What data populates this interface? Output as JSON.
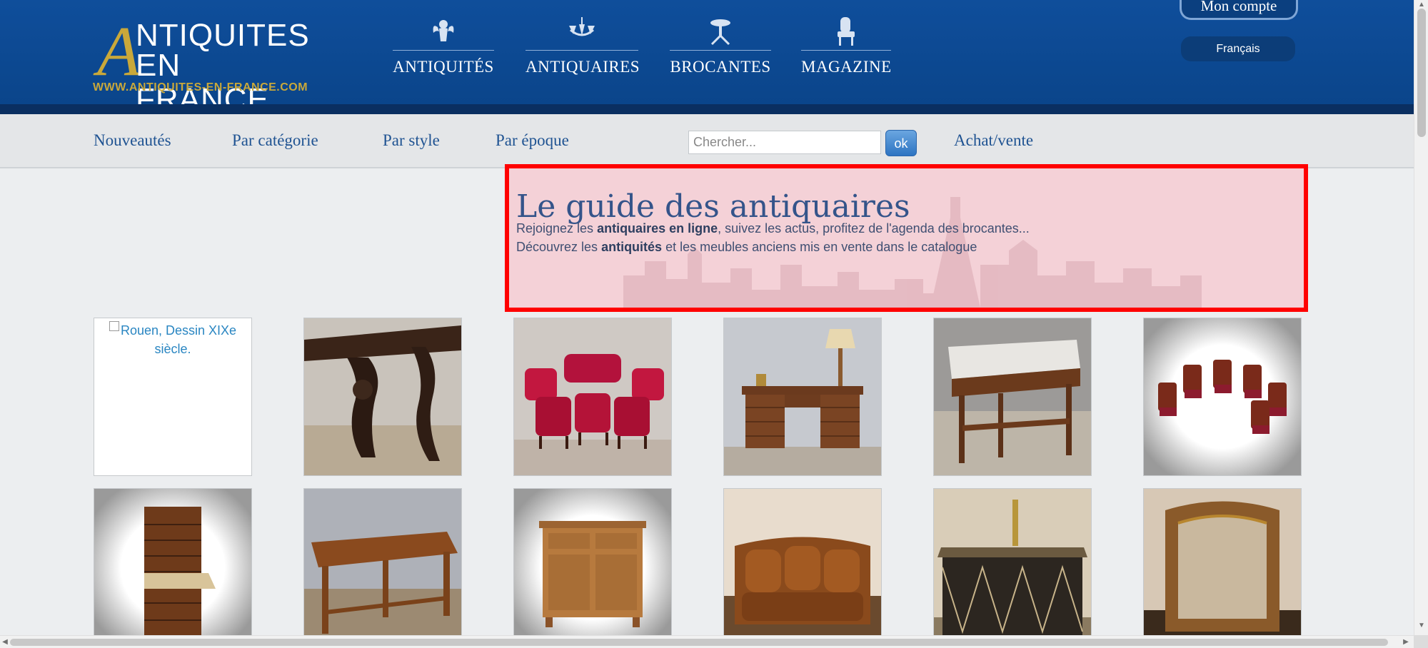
{
  "header": {
    "logo": {
      "letter": "A",
      "line1": "NTIQUITES",
      "line2": "EN FRANCE",
      "url": "WWW.ANTIQUITES-EN-FRANCE.COM"
    },
    "nav": [
      {
        "label": "ANTIQUITÉS",
        "icon": "cherub-icon"
      },
      {
        "label": "ANTIQUAIRES",
        "icon": "chandelier-icon"
      },
      {
        "label": "BROCANTES",
        "icon": "pedestal-table-icon"
      },
      {
        "label": "MAGAZINE",
        "icon": "armchair-icon"
      }
    ],
    "account_label": "Mon compte",
    "language_label": "Français"
  },
  "subnav": {
    "links": [
      "Nouveautés",
      "Par catégorie",
      "Par style",
      "Par époque"
    ],
    "search_placeholder": "Chercher...",
    "search_button": "ok",
    "buy_sell": "Achat/vente"
  },
  "intro": {
    "title": "Le guide des antiquaires",
    "line1_pre": "Rejoignez les ",
    "line1_bold": "antiquaires en ligne",
    "line1_post": ", suivez les actus, profitez de l'agenda des brocantes...",
    "line2_pre": "Découvrez les ",
    "line2_bold": "antiquités",
    "line2_post": " et les meubles anciens mis en vente dans le catalogue"
  },
  "products": [
    {
      "alt": "Rouen, Dessin XIXe siècle.",
      "broken": true
    },
    {
      "subject": "carved-console-table"
    },
    {
      "subject": "red-salon-set"
    },
    {
      "subject": "writing-desk-with-lamp"
    },
    {
      "subject": "marble-top-table"
    },
    {
      "subject": "six-chairs-circle"
    },
    {
      "subject": "secretary-chest"
    },
    {
      "subject": "long-farm-table"
    },
    {
      "subject": "buffet-sideboard"
    },
    {
      "subject": "leather-sofa"
    },
    {
      "subject": "bar-counter"
    },
    {
      "subject": "gilt-mirror"
    }
  ],
  "colors": {
    "header_blue": "#0f4e9b",
    "gold": "#c9a83a",
    "link_blue": "#1f5392",
    "highlight_border": "#ff0000"
  }
}
